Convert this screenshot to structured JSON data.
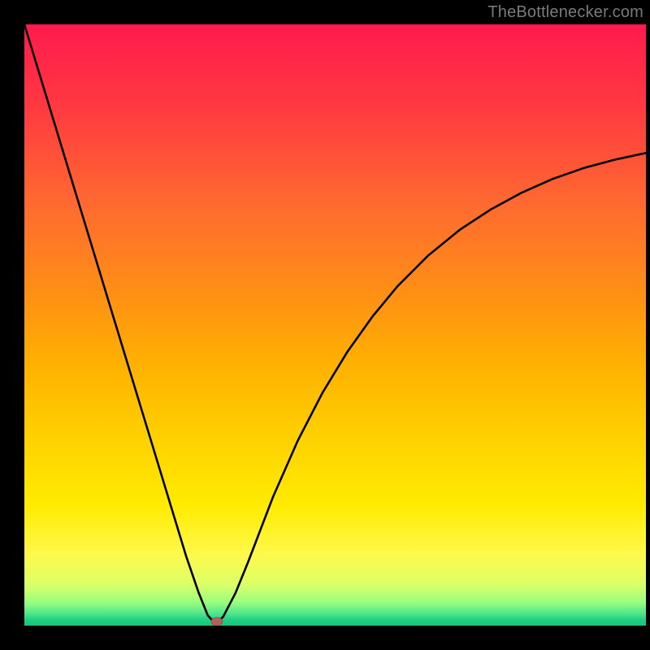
{
  "attribution": "TheBottlenecker.com",
  "chart_data": {
    "type": "line",
    "title": "",
    "xlabel": "",
    "ylabel": "",
    "xlim": [
      0,
      100
    ],
    "ylim": [
      0,
      100
    ],
    "x": [
      0,
      2,
      4,
      6,
      8,
      10,
      12,
      14,
      16,
      18,
      20,
      22,
      24,
      26,
      28,
      29.5,
      30.5,
      31,
      32,
      34,
      36,
      38,
      40,
      44,
      48,
      52,
      56,
      60,
      65,
      70,
      75,
      80,
      85,
      90,
      95,
      100
    ],
    "values": [
      100,
      93.2,
      86.4,
      79.6,
      72.8,
      66.0,
      59.2,
      52.4,
      45.6,
      38.8,
      32.0,
      25.2,
      18.4,
      11.6,
      5.6,
      1.7,
      0.6,
      0.5,
      1.5,
      5.5,
      10.6,
      16.0,
      21.4,
      30.8,
      38.8,
      45.6,
      51.4,
      56.4,
      61.6,
      65.8,
      69.2,
      72.0,
      74.3,
      76.1,
      77.5,
      78.6
    ],
    "marker": {
      "x": 31,
      "y": 0.5
    },
    "series": [
      {
        "name": "curve",
        "color": "#000000"
      }
    ]
  },
  "colors": {
    "background": "#000000",
    "curve": "#000000",
    "marker": "#b3625b"
  }
}
